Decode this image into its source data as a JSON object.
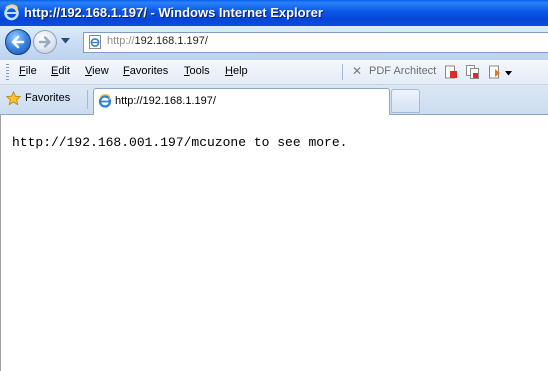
{
  "window": {
    "title": "http://192.168.1.197/ - Windows Internet Explorer"
  },
  "navigation": {
    "address_protocol": "http://",
    "address_host": "192.168.1.197/"
  },
  "menu": {
    "items": [
      "File",
      "Edit",
      "View",
      "Favorites",
      "Tools",
      "Help"
    ],
    "pdf_architect_label": "PDF Architect"
  },
  "favorites_bar": {
    "label": "Favorites"
  },
  "tabs": [
    {
      "label": "http://192.168.1.197/"
    }
  ],
  "page": {
    "body_text": "http://192.168.001.197/mcuzone to see more."
  },
  "colors": {
    "titlebar": "#0a55e8",
    "toolbar": "#c9dcf3",
    "content_background": "#ffffff"
  },
  "icons": {
    "browser_logo": "ie-logo-icon",
    "back": "back-arrow-icon",
    "forward": "forward-arrow-icon",
    "favorites": "star-icon",
    "pdf_close": "close-icon"
  }
}
